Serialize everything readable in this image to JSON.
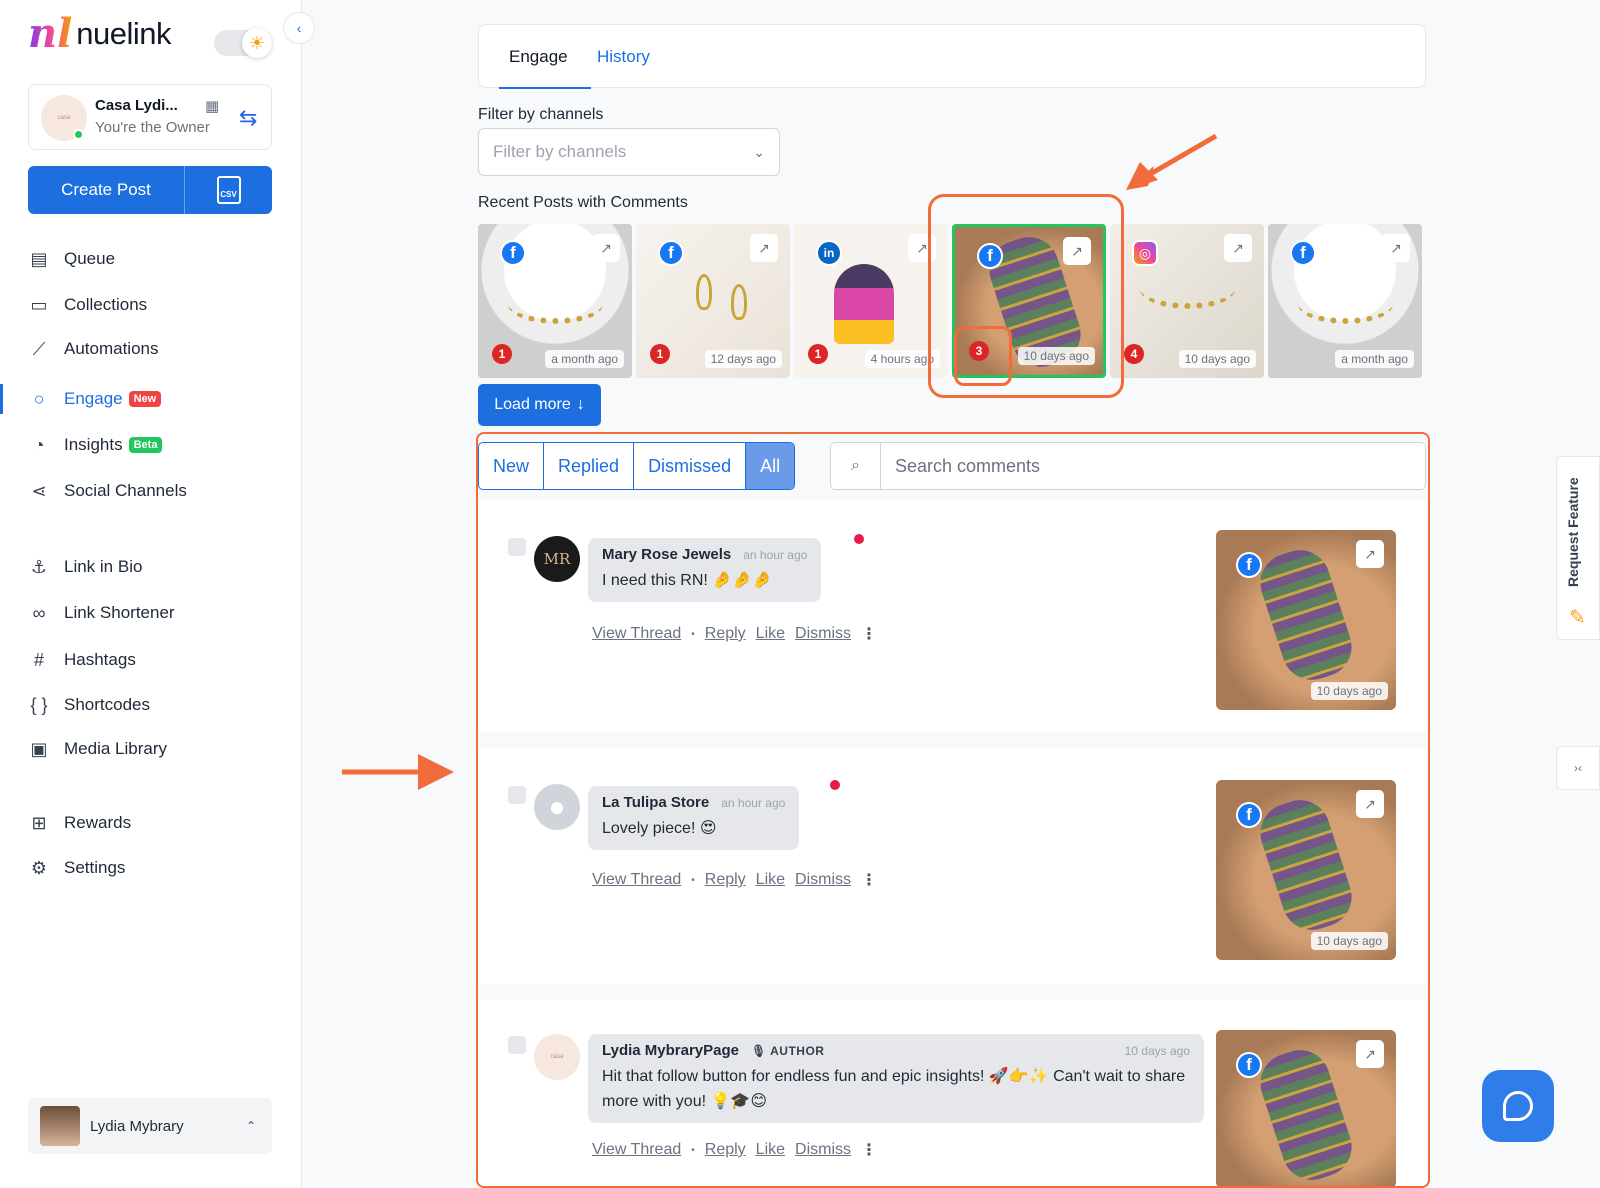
{
  "brand": {
    "name": "nuelink"
  },
  "account": {
    "name": "Casa Lydi...",
    "role": "You're the Owner"
  },
  "create_post": {
    "label": "Create Post",
    "csv_label": "CSV"
  },
  "nav": {
    "queue": "Queue",
    "collections": "Collections",
    "automations": "Automations",
    "engage": "Engage",
    "engage_badge": "New",
    "insights": "Insights",
    "insights_badge": "Beta",
    "social_channels": "Social Channels",
    "link_in_bio": "Link in Bio",
    "link_shortener": "Link Shortener",
    "hashtags": "Hashtags",
    "shortcodes": "Shortcodes",
    "media_library": "Media Library",
    "rewards": "Rewards",
    "settings": "Settings"
  },
  "user": {
    "name": "Lydia Mybrary"
  },
  "tabs": {
    "engage": "Engage",
    "history": "History"
  },
  "filter": {
    "label": "Filter by channels",
    "placeholder": "Filter by channels"
  },
  "recent": {
    "label": "Recent Posts with Comments",
    "posts": [
      {
        "network": "facebook",
        "count": "1",
        "time": "a month ago"
      },
      {
        "network": "facebook",
        "count": "1",
        "time": "12 days ago"
      },
      {
        "network": "linkedin",
        "count": "1",
        "time": "4 hours ago"
      },
      {
        "network": "facebook",
        "count": "3",
        "time": "10 days ago",
        "selected": true
      },
      {
        "network": "instagram",
        "count": "4",
        "time": "10 days ago"
      },
      {
        "network": "facebook",
        "count": "",
        "time": "a month ago"
      }
    ],
    "load_more": "Load more"
  },
  "comment_filters": {
    "new": "New",
    "replied": "Replied",
    "dismissed": "Dismissed",
    "all": "All",
    "active": "All"
  },
  "search": {
    "placeholder": "Search comments"
  },
  "comments": [
    {
      "author": "Mary Rose Jewels",
      "time": "an hour ago",
      "text": "I need this RN! 🤌🤌🤌",
      "post_time": "10 days ago",
      "unread": true
    },
    {
      "author": "La Tulipa Store",
      "time": "an hour ago",
      "text": "Lovely piece! 😍",
      "post_time": "10 days ago",
      "unread": true
    },
    {
      "author": "Lydia MybraryPage",
      "author_tag": "AUTHOR",
      "time": "10 days ago",
      "text": "Hit that follow button for endless fun and epic insights! 🚀👉✨ Can't wait to share more with you! 💡🎓😊",
      "post_time": "",
      "unread": false
    }
  ],
  "comment_actions": {
    "view_thread": "View Thread",
    "reply": "Reply",
    "like": "Like",
    "dismiss": "Dismiss"
  },
  "right_rail": {
    "request_feature": "Request Feature"
  },
  "colors": {
    "primary": "#1d6fe0",
    "annotation": "#f26b3a",
    "selected": "#22c55e",
    "unread": "#e11d48"
  }
}
